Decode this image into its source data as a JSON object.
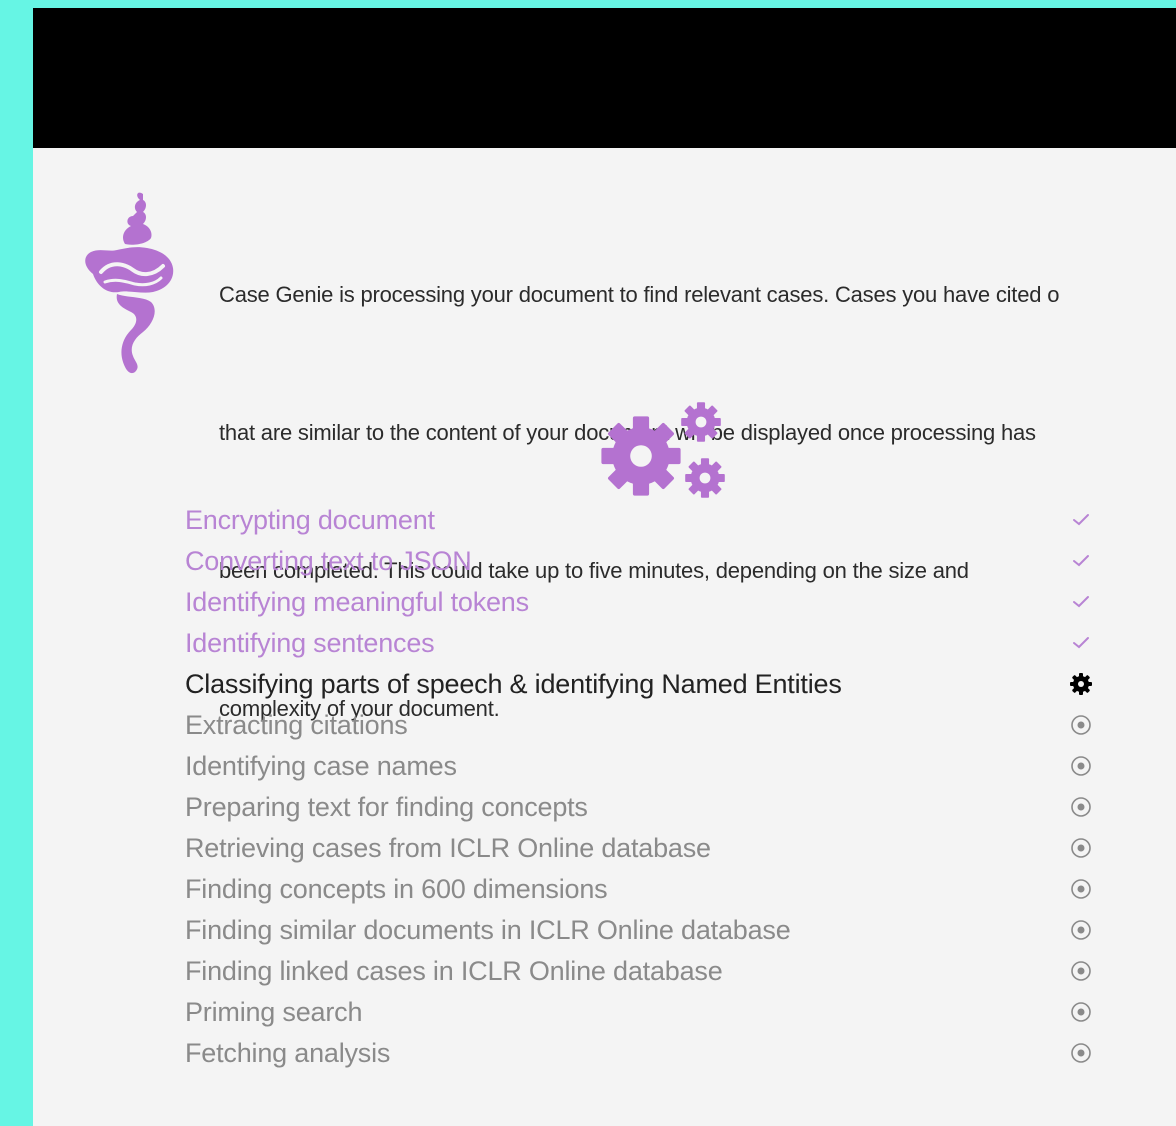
{
  "intro": {
    "lines": [
      "Case Genie is processing your document to find relevant cases. Cases you have cited o",
      "that are similar to the content of your document will be displayed once processing has",
      "been completed. This could take up to five minutes, depending on the size and",
      "complexity of your document."
    ]
  },
  "icons": {
    "logo": "genie-icon",
    "processing": "gears-icon"
  },
  "colors": {
    "accent": "#B884D4",
    "genie": "#B472D0",
    "background": "#66F5E4",
    "header": "#000000"
  },
  "steps": [
    {
      "label": "Encrypting document",
      "status": "done"
    },
    {
      "label": "Converting text to JSON",
      "status": "done"
    },
    {
      "label": "Identifying meaningful tokens",
      "status": "done"
    },
    {
      "label": "Identifying sentences",
      "status": "done"
    },
    {
      "label": "Classifying parts of speech & identifying Named Entities",
      "status": "active"
    },
    {
      "label": "Extracting citations",
      "status": "pending"
    },
    {
      "label": "Identifying case names",
      "status": "pending"
    },
    {
      "label": "Preparing text for finding concepts",
      "status": "pending"
    },
    {
      "label": "Retrieving cases from ICLR Online database",
      "status": "pending"
    },
    {
      "label": "Finding concepts in 600 dimensions",
      "status": "pending"
    },
    {
      "label": "Finding similar documents in ICLR Online database",
      "status": "pending"
    },
    {
      "label": "Finding linked cases in ICLR Online database",
      "status": "pending"
    },
    {
      "label": "Priming search",
      "status": "pending"
    },
    {
      "label": "Fetching analysis",
      "status": "pending"
    }
  ]
}
